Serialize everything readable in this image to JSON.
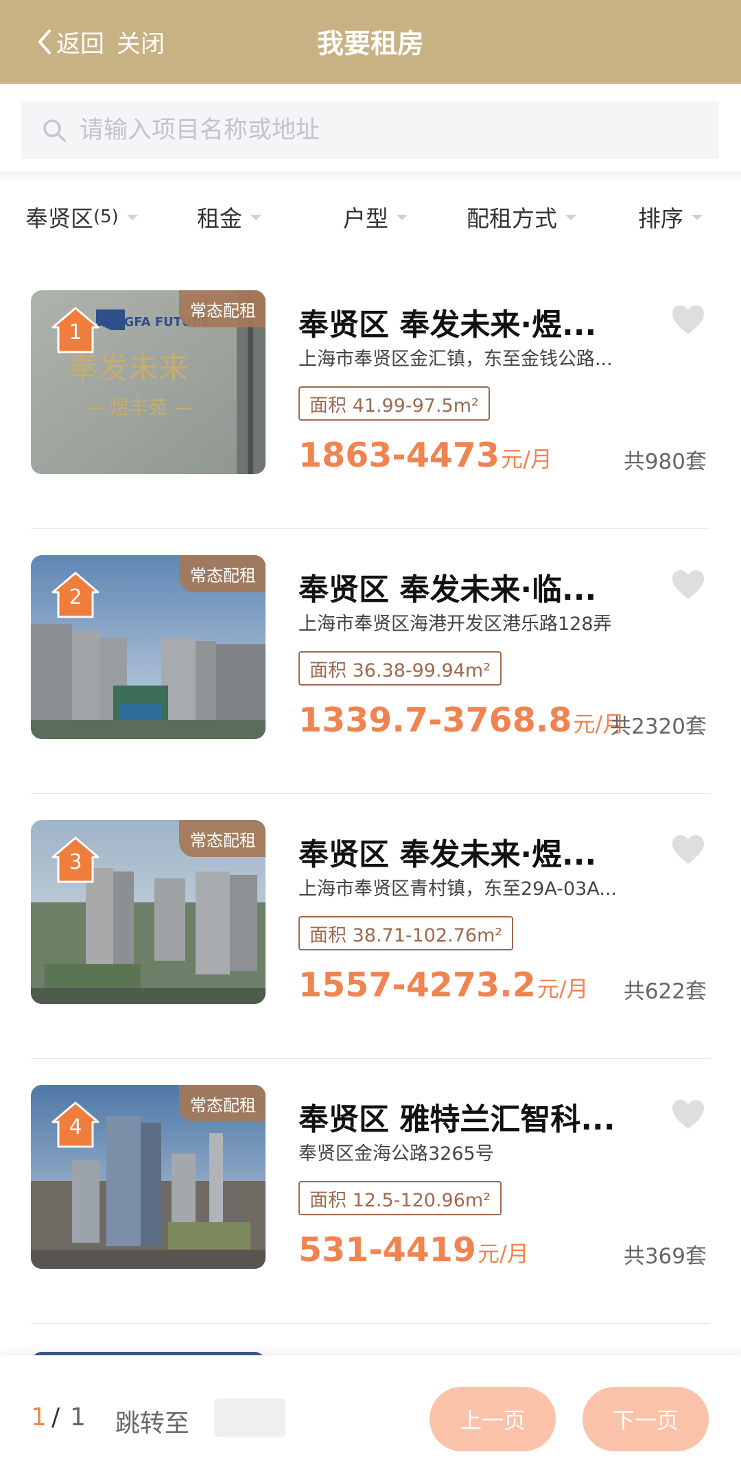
{
  "header": {
    "back_label": "返回",
    "close_label": "关闭",
    "title": "我要租房"
  },
  "search": {
    "placeholder": "请输入项目名称或地址"
  },
  "filters": {
    "district_label": "奉贤区",
    "district_count": "(5)",
    "rent_label": "租金",
    "layout_label": "户型",
    "allocation_label": "配租方式",
    "sort_label": "排序"
  },
  "listings": [
    {
      "rank": "1",
      "tag": "常态配租",
      "title": "奉贤区 奉发未来·煜...",
      "address": "上海市奉贤区金汇镇，东至金钱公路...",
      "area": "面积 41.99-97.5m²",
      "price": "1863-4473",
      "price_unit": "元/月",
      "total": "共980套",
      "photo_sign_text": "奉发未来",
      "photo_sign_sub": "— 煜丰苑 —",
      "photo_logo_text": "FENGFA FUTURE"
    },
    {
      "rank": "2",
      "tag": "常态配租",
      "title": "奉贤区 奉发未来·临...",
      "address": "上海市奉贤区海港开发区港乐路128弄",
      "area": "面积 36.38-99.94m²",
      "price": "1339.7-3768.8",
      "price_unit": "元/月",
      "total": "共2320套"
    },
    {
      "rank": "3",
      "tag": "常态配租",
      "title": "奉贤区 奉发未来·煜...",
      "address": "上海市奉贤区青村镇，东至29A-03A...",
      "area": "面积 38.71-102.76m²",
      "price": "1557-4273.2",
      "price_unit": "元/月",
      "total": "共622套"
    },
    {
      "rank": "4",
      "tag": "常态配租",
      "title": "奉贤区 雅特兰汇智科...",
      "address": "奉贤区金海公路3265号",
      "area": "面积 12.5-120.96m²",
      "price": "531-4419",
      "price_unit": "元/月",
      "total": "共369套"
    }
  ],
  "pager": {
    "current": "1",
    "separator": "/",
    "total": "1",
    "jump_label": "跳转至",
    "prev_label": "上一页",
    "next_label": "下一页"
  },
  "colors": {
    "header_bg": "#c8b183",
    "price": "#f0834f",
    "tag_bg": "#a57858",
    "area_border": "#9c6a4f",
    "pager_button": "#f9c2a9"
  },
  "icons": {
    "back": "chevron-left-icon",
    "search": "search-icon",
    "favorite": "heart-icon",
    "rank": "house-badge-icon"
  }
}
